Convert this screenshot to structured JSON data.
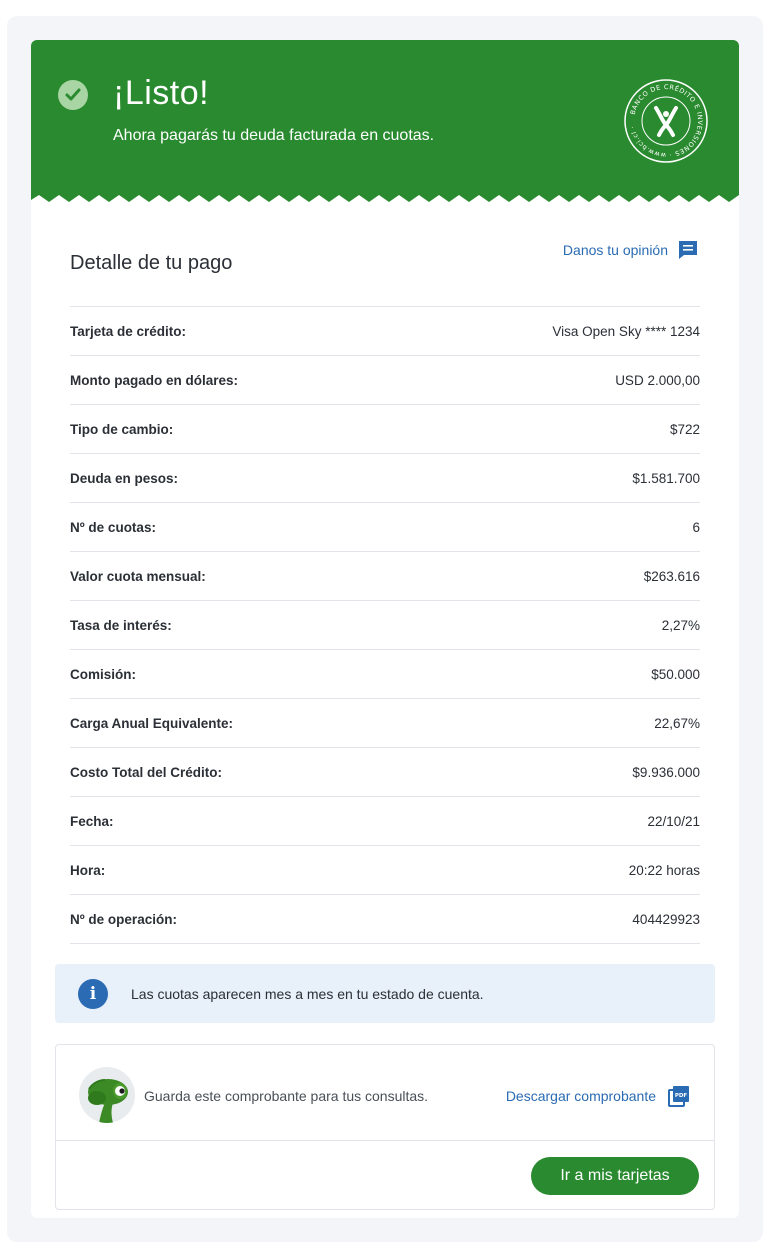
{
  "colors": {
    "brand_green": "#2a8a2f",
    "link_blue": "#2a6bb3",
    "info_bg": "#e8f0fa"
  },
  "banner": {
    "title": "¡Listo!",
    "subtitle": "Ahora pagarás tu deuda facturada en cuotas.",
    "seal_text": "BANCO DE CRÉDITO E INVERSIONES",
    "seal_url": "www.bci.cl",
    "icon": "check-circle-icon"
  },
  "detail": {
    "title": "Detalle de tu pago",
    "opinion_label": "Danos tu opinión",
    "rows": [
      {
        "label": "Tarjeta de crédito:",
        "value": "Visa Open Sky **** 1234"
      },
      {
        "label": "Monto pagado en dólares:",
        "value": "USD 2.000,00"
      },
      {
        "label": "Tipo de cambio:",
        "value": "$722"
      },
      {
        "label": "Deuda en pesos:",
        "value": "$1.581.700"
      },
      {
        "label": "Nº de cuotas:",
        "value": "6"
      },
      {
        "label": "Valor cuota mensual:",
        "value": "$263.616"
      },
      {
        "label": "Tasa de interés:",
        "value": "2,27%"
      },
      {
        "label": "Comisión:",
        "value": "$50.000"
      },
      {
        "label": "Carga Anual Equivalente:",
        "value": "22,67%"
      },
      {
        "label": "Costo Total del Crédito:",
        "value": "$9.936.000"
      },
      {
        "label": "Fecha:",
        "value": "22/10/21"
      },
      {
        "label": "Hora:",
        "value": "20:22 horas"
      },
      {
        "label": "Nº de operación:",
        "value": "404429923"
      }
    ]
  },
  "info": {
    "text": "Las cuotas aparecen mes a mes en tu estado de cuenta.",
    "icon_glyph": "i"
  },
  "receipt": {
    "text": "Guarda este comprobante para tus consultas.",
    "download_label": "Descargar comprobante",
    "pdf_badge": "PDF",
    "cta_label": "Ir a mis tarjetas"
  }
}
